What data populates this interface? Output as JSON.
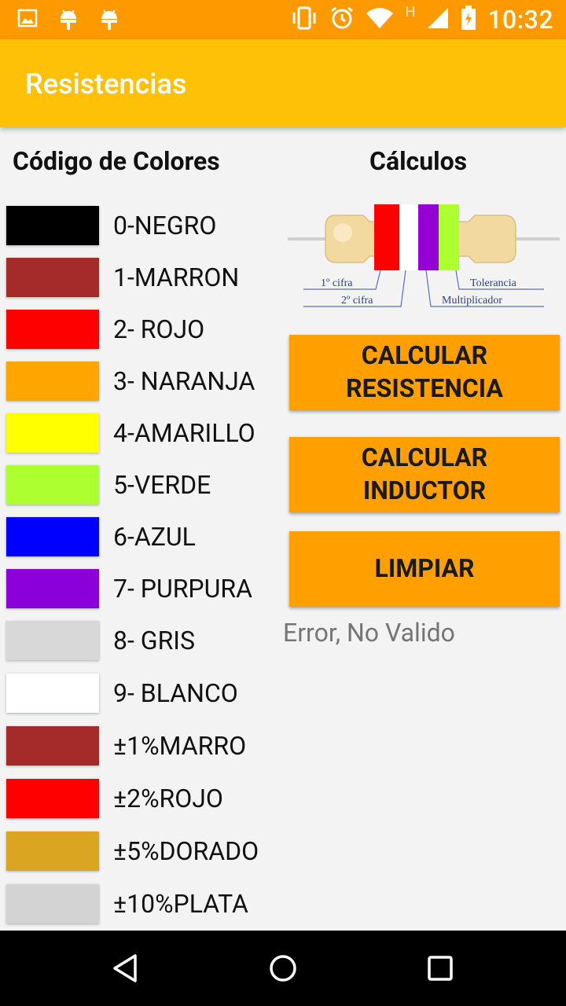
{
  "status_bar": {
    "time": "10:32",
    "network_label": "H",
    "icons": [
      "image-icon",
      "android-icon",
      "android-icon",
      "vibrate-icon",
      "alarm-icon",
      "wifi-icon",
      "signal-icon",
      "battery-icon"
    ]
  },
  "app_bar": {
    "title": "Resistencias"
  },
  "left_heading": "Código de Colores",
  "right_heading": "Cálculos",
  "color_codes": [
    {
      "label": "0-NEGRO",
      "color": "#000000"
    },
    {
      "label": "1-MARRON",
      "color": "#a52a2a"
    },
    {
      "label": "2- ROJO",
      "color": "#ff0000"
    },
    {
      "label": "3- NARANJA",
      "color": "#ffa500"
    },
    {
      "label": "4-AMARILLO",
      "color": "#ffff00"
    },
    {
      "label": "5-VERDE",
      "color": "#adff2f"
    },
    {
      "label": "6-AZUL",
      "color": "#0000ff"
    },
    {
      "label": "7- PURPURA",
      "color": "#8b00d8"
    },
    {
      "label": "8- GRIS",
      "color": "#d8d8d8"
    },
    {
      "label": "9- BLANCO",
      "color": "#ffffff"
    },
    {
      "label": "±1%MARRO",
      "color": "#a52a2a"
    },
    {
      "label": "±2%ROJO",
      "color": "#ff0000"
    },
    {
      "label": "±5%DORADO",
      "color": "#daa520"
    },
    {
      "label": "±10%PLATA",
      "color": "#d3d3d3"
    }
  ],
  "resistor_diagram": {
    "band_colors": [
      "#ff0000",
      "#ffffff",
      "#9400d3",
      "#adff2f"
    ],
    "labels": {
      "first_digit": "1º cifra",
      "second_digit": "2º cifra",
      "multiplier": "Multiplicador",
      "tolerance": "Tolerancia"
    }
  },
  "buttons": {
    "calc_resistance": "CALCULAR RESISTENCIA",
    "calc_inductor": "CALCULAR INDUCTOR",
    "clear": "LIMPIAR"
  },
  "result_text": "Error, No Valido",
  "colors": {
    "status_bar": "#ff9900",
    "app_bar": "#ffc107",
    "button": "#ffa000"
  }
}
